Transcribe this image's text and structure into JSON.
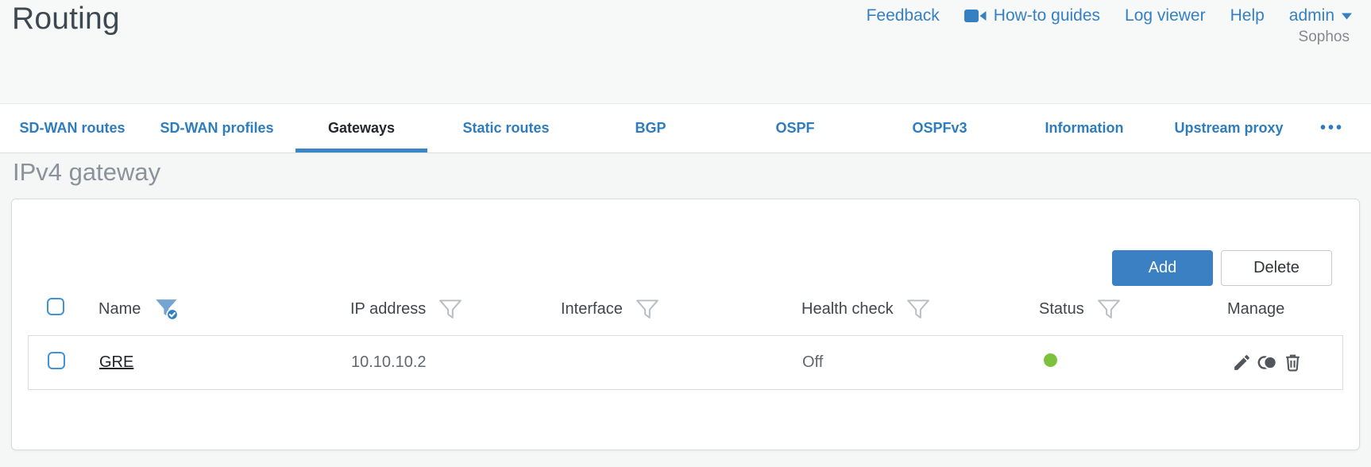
{
  "header": {
    "title": "Routing",
    "brand": "Sophos",
    "nav": {
      "feedback": "Feedback",
      "howto": "How-to guides",
      "log_viewer": "Log viewer",
      "help": "Help",
      "user": "admin"
    }
  },
  "tabs": [
    {
      "label": "SD-WAN routes",
      "active": false
    },
    {
      "label": "SD-WAN profiles",
      "active": false
    },
    {
      "label": "Gateways",
      "active": true
    },
    {
      "label": "Static routes",
      "active": false
    },
    {
      "label": "BGP",
      "active": false
    },
    {
      "label": "OSPF",
      "active": false
    },
    {
      "label": "OSPFv3",
      "active": false
    },
    {
      "label": "Information",
      "active": false
    },
    {
      "label": "Upstream proxy",
      "active": false
    }
  ],
  "tabs_overflow": "•••",
  "section": {
    "heading": "IPv4 gateway"
  },
  "toolbar": {
    "add": "Add",
    "delete": "Delete"
  },
  "table": {
    "columns": [
      {
        "label": "Name",
        "filter": "active"
      },
      {
        "label": "IP address",
        "filter": "default"
      },
      {
        "label": "Interface",
        "filter": "default"
      },
      {
        "label": "Health check",
        "filter": "default"
      },
      {
        "label": "Status",
        "filter": "default"
      },
      {
        "label": "Manage",
        "filter": "none"
      }
    ],
    "rows": [
      {
        "name": "GRE",
        "ip_address": "10.10.10.2",
        "interface": "",
        "health_check": "Off",
        "status": "up",
        "status_color": "#7cc23d"
      }
    ]
  },
  "colors": {
    "accent_blue": "#3580c2",
    "tab_underline": "#3a86c7",
    "status_green": "#7cc23d"
  }
}
